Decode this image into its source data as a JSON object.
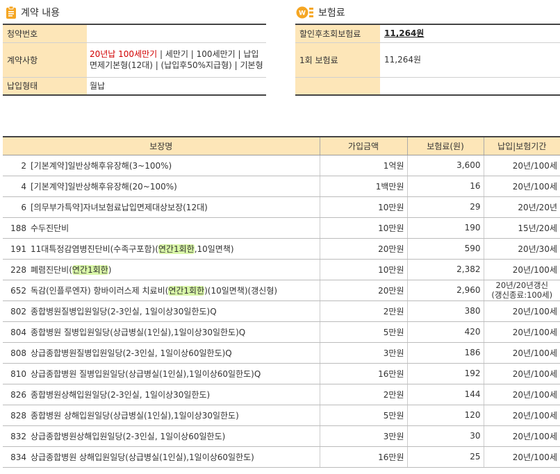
{
  "contract": {
    "title": "계약 내용",
    "rows": [
      {
        "label": "청약번호",
        "value": ""
      },
      {
        "label": "계약사항",
        "value_red": "20년납 100세만기",
        "value_rest": " | 세만기 | 100세만기 | 납입면제기본형(12대) | (납입후50%지급형) | 기본형"
      },
      {
        "label": "납입형태",
        "value": "월납"
      }
    ]
  },
  "premium": {
    "title": "보험료",
    "rows": [
      {
        "label": "할인후초회보험료",
        "value": "11,264원"
      },
      {
        "label": "1회 보험료",
        "value": "11,264원"
      },
      {
        "label": "",
        "value": ""
      }
    ]
  },
  "coverage": {
    "headers": [
      "보장명",
      "가입금액",
      "보험료(원)",
      "납입|보험기간"
    ],
    "rows": [
      {
        "no": "2",
        "name": "[기본계약]일반상해후유장해(3~100%)",
        "hl": "",
        "tail": "",
        "amount": "1억원",
        "premium": "3,600",
        "period": "20년/100세"
      },
      {
        "no": "4",
        "name": "[기본계약]일반상해후유장해(20~100%)",
        "hl": "",
        "tail": "",
        "amount": "1백만원",
        "premium": "16",
        "period": "20년/100세"
      },
      {
        "no": "6",
        "name": "[의무부가특약]자녀보험료납입면제대상보장(12대)",
        "hl": "",
        "tail": "",
        "amount": "10만원",
        "premium": "29",
        "period": "20년/20년"
      },
      {
        "no": "188",
        "name": "수두진단비",
        "hl": "",
        "tail": "",
        "amount": "10만원",
        "premium": "190",
        "period": "15년/20세"
      },
      {
        "no": "191",
        "name": "11대특정감염병진단비(수족구포함)(",
        "hl": "연간1회한",
        "tail": ",10일면책)",
        "amount": "20만원",
        "premium": "590",
        "period": "20년/30세"
      },
      {
        "no": "228",
        "name": "폐렴진단비(",
        "hl": "연간1회한",
        "tail": ")",
        "amount": "10만원",
        "premium": "2,382",
        "period": "20년/100세"
      },
      {
        "no": "652",
        "name": "독감(인플루엔자) 항바이러스제 치료비(",
        "hl": "연간1회한",
        "tail": ")(10일면책)(갱신형)",
        "amount": "20만원",
        "premium": "2,960",
        "period": "20년/20년갱신",
        "period2": "(갱신종료:100세)"
      },
      {
        "no": "802",
        "name": "종합병원질병입원일당(2-3인실, 1일이상30일한도)Q",
        "hl": "",
        "tail": "",
        "amount": "2만원",
        "premium": "380",
        "period": "20년/100세"
      },
      {
        "no": "804",
        "name": "종합병원 질병입원일당(상급병실(1인실),1일이상30일한도)Q",
        "hl": "",
        "tail": "",
        "amount": "5만원",
        "premium": "420",
        "period": "20년/100세"
      },
      {
        "no": "808",
        "name": "상급종합병원질병입원일당(2-3인실, 1일이상60일한도)Q",
        "hl": "",
        "tail": "",
        "amount": "3만원",
        "premium": "186",
        "period": "20년/100세"
      },
      {
        "no": "810",
        "name": "상급종합병원 질병입원일당(상급병실(1인실),1일이상60일한도)Q",
        "hl": "",
        "tail": "",
        "amount": "16만원",
        "premium": "192",
        "period": "20년/100세"
      },
      {
        "no": "826",
        "name": "종합병원상해입원일당(2-3인실, 1일이상30일한도)",
        "hl": "",
        "tail": "",
        "amount": "2만원",
        "premium": "144",
        "period": "20년/100세"
      },
      {
        "no": "828",
        "name": "종합병원 상해입원일당(상급병실(1인실),1일이상30일한도)",
        "hl": "",
        "tail": "",
        "amount": "5만원",
        "premium": "120",
        "period": "20년/100세"
      },
      {
        "no": "832",
        "name": "상급종합병원상해입원일당(2-3인실, 1일이상60일한도)",
        "hl": "",
        "tail": "",
        "amount": "3만원",
        "premium": "30",
        "period": "20년/100세"
      },
      {
        "no": "834",
        "name": "상급종합병원 상해입원일당(상급병실(1인실),1일이상60일한도)",
        "hl": "",
        "tail": "",
        "amount": "16만원",
        "premium": "25",
        "period": "20년/100세"
      }
    ]
  },
  "colors": {
    "label_bg": "#fde6b8",
    "accent": "#f5a623",
    "red": "#d10000",
    "highlight": "#d9f7a8"
  },
  "icons": {
    "contract": "clipboard-icon",
    "premium": "we-logo-icon"
  }
}
